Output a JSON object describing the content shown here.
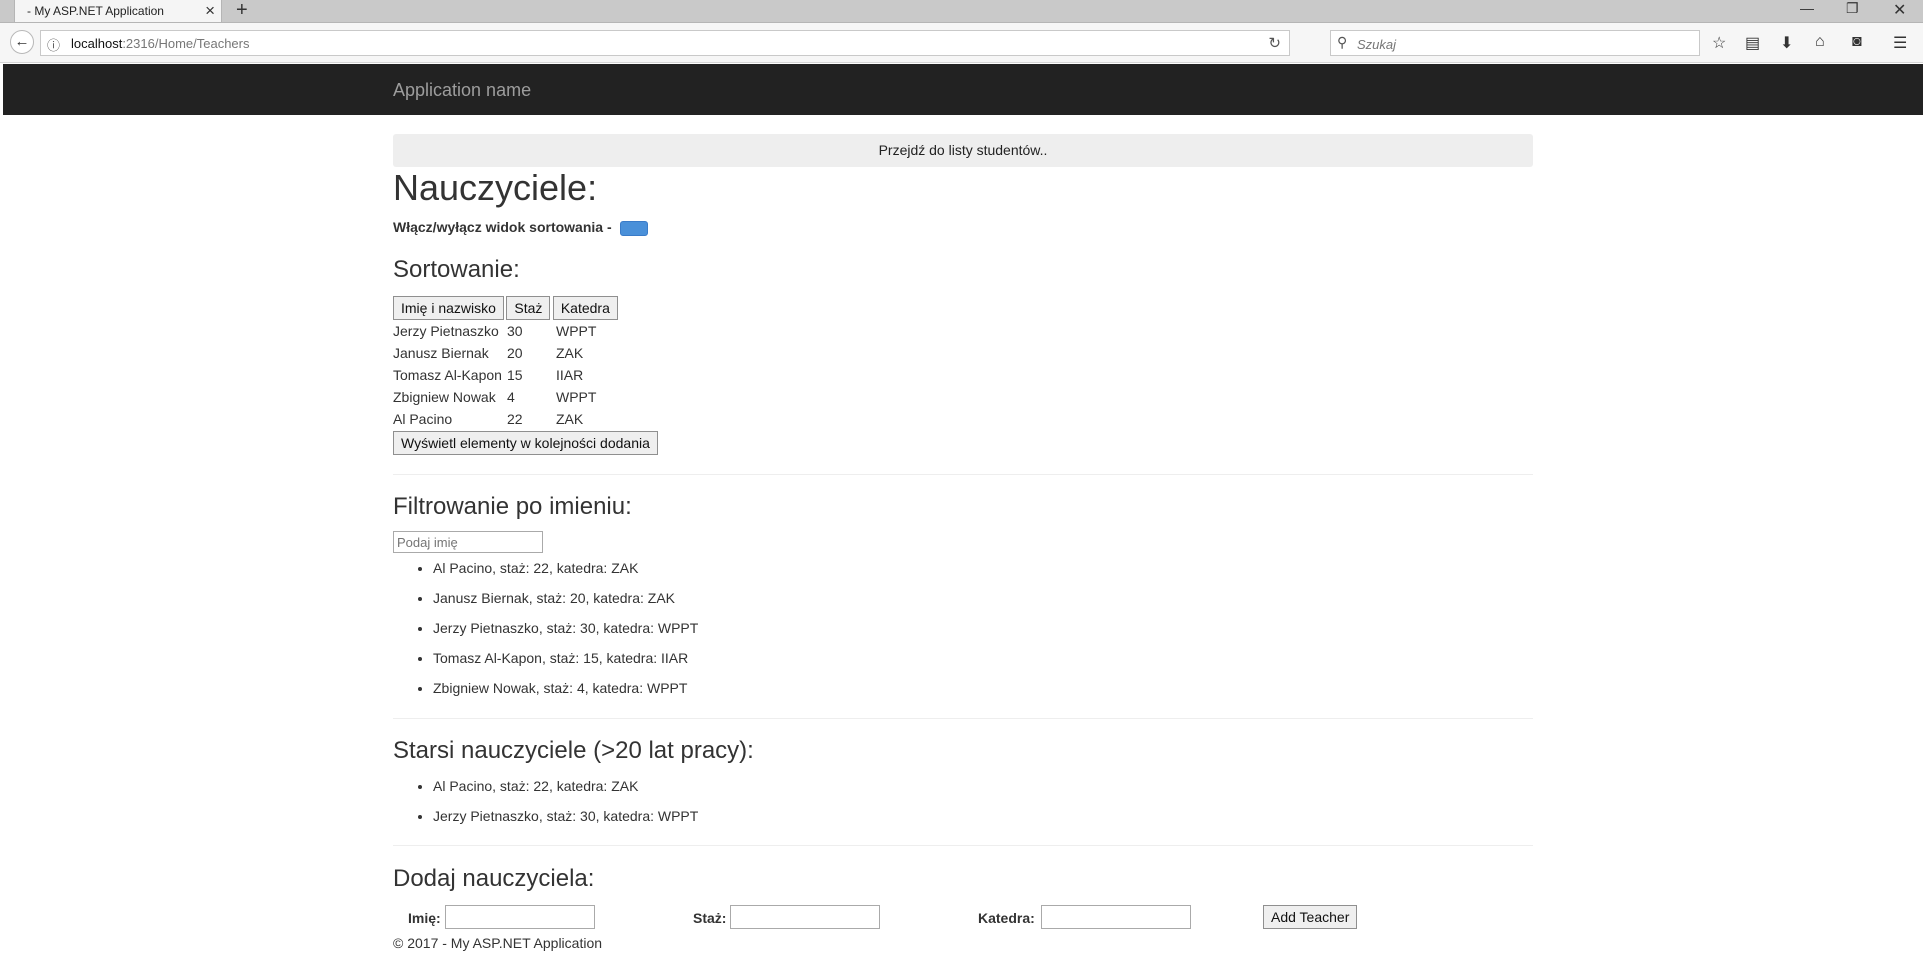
{
  "browser": {
    "tab_title": "- My ASP.NET Application",
    "url_host": "localhost",
    "url_rest": ":2316/Home/Teachers",
    "search_placeholder": "Szukaj"
  },
  "navbar": {
    "brand": "Application name"
  },
  "students_link": "Przejdź do listy studentów..",
  "page_title": "Nauczyciele:",
  "toggle_label": "Włącz/wyłącz widok sortowania -",
  "sorting": {
    "title": "Sortowanie:",
    "buttons": [
      "Imię i nazwisko",
      "Staż",
      "Katedra"
    ],
    "rows": [
      [
        "Jerzy Pietnaszko",
        "30",
        "WPPT"
      ],
      [
        "Janusz Biernak",
        "20",
        "ZAK"
      ],
      [
        "Tomasz Al-Kapon",
        "15",
        "IIAR"
      ],
      [
        "Zbigniew Nowak",
        "4",
        "WPPT"
      ],
      [
        "Al Pacino",
        "22",
        "ZAK"
      ]
    ],
    "order_button": "Wyświetl elementy w kolejności dodania"
  },
  "filter": {
    "title": "Filtrowanie po imieniu:",
    "placeholder": "Podaj imię",
    "items": [
      "Al Pacino, staż: 22, katedra: ZAK",
      "Janusz Biernak, staż: 20, katedra: ZAK",
      "Jerzy Pietnaszko, staż: 30, katedra: WPPT",
      "Tomasz Al-Kapon, staż: 15, katedra: IIAR",
      "Zbigniew Nowak, staż: 4, katedra: WPPT"
    ]
  },
  "senior": {
    "title": "Starsi nauczyciele (>20 lat pracy):",
    "items": [
      "Al Pacino, staż: 22, katedra: ZAK",
      "Jerzy Pietnaszko, staż: 30, katedra: WPPT"
    ]
  },
  "add": {
    "title": "Dodaj nauczyciela:",
    "name_label": "Imię:",
    "exp_label": "Staż:",
    "dept_label": "Katedra:",
    "button": "Add Teacher"
  },
  "footer": "© 2017 - My ASP.NET Application",
  "colors": {
    "navbar_bg": "#222222",
    "toggle": "#4a90d9"
  }
}
